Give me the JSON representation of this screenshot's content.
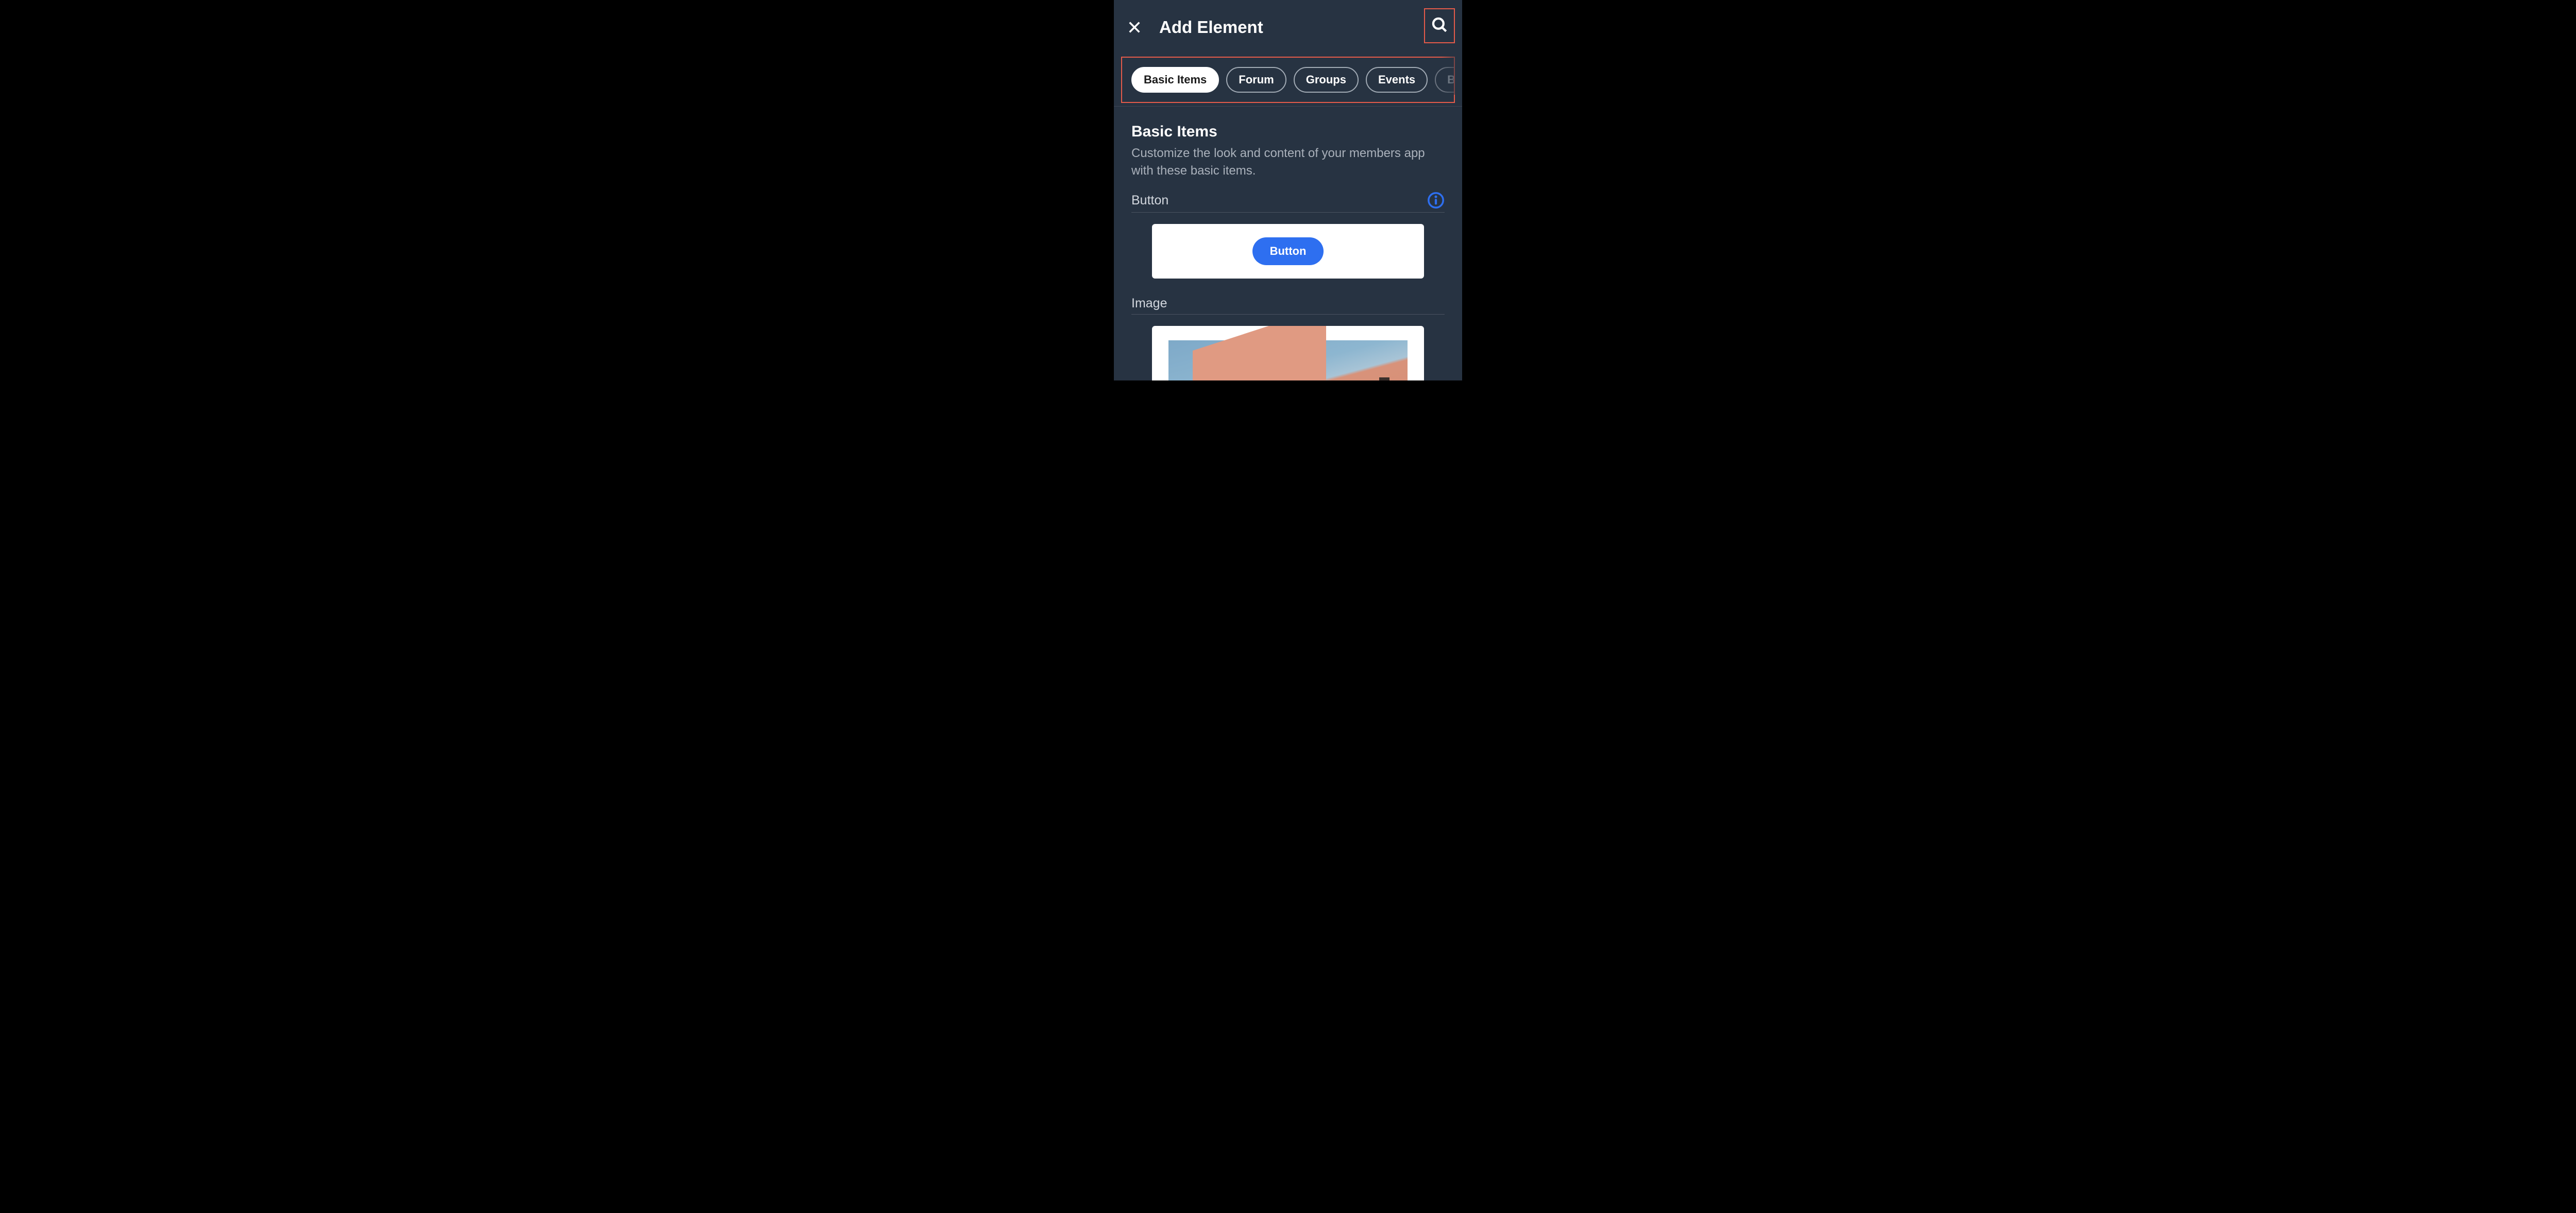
{
  "header": {
    "title": "Add Element"
  },
  "tabs": [
    {
      "label": "Basic Items",
      "active": true
    },
    {
      "label": "Forum",
      "active": false
    },
    {
      "label": "Groups",
      "active": false
    },
    {
      "label": "Events",
      "active": false
    },
    {
      "label": "Blog",
      "active": false,
      "faded": true
    }
  ],
  "section": {
    "title": "Basic Items",
    "description": "Customize the look and content of your members app with these basic items."
  },
  "items": {
    "button": {
      "label": "Button",
      "preview_button_label": "Button"
    },
    "image": {
      "label": "Image"
    }
  },
  "colors": {
    "highlight": "#e55b4a",
    "accent": "#2e6ff0",
    "panel_bg": "#273342"
  }
}
